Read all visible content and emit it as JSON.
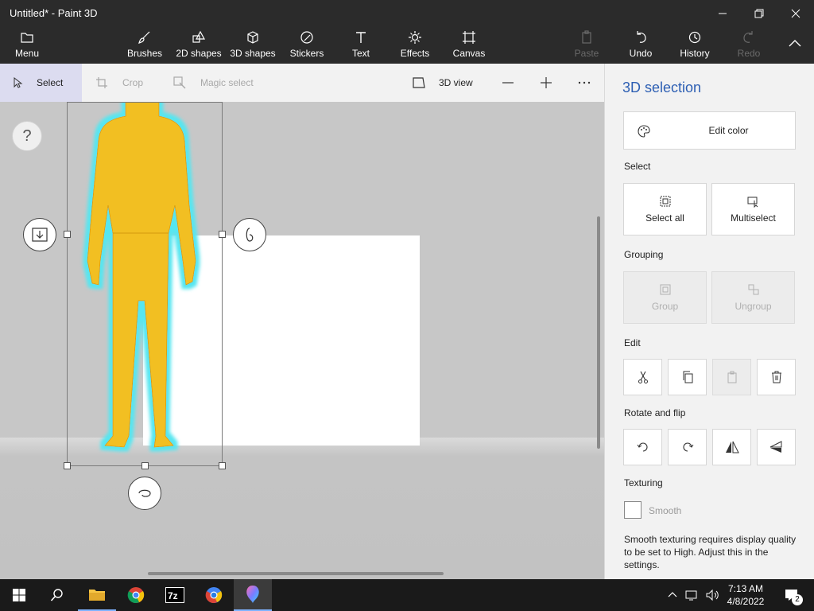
{
  "window": {
    "title": "Untitled* - Paint 3D"
  },
  "toolbar": {
    "menu": "Menu",
    "brushes": "Brushes",
    "shapes2d": "2D shapes",
    "shapes3d": "3D shapes",
    "stickers": "Stickers",
    "text": "Text",
    "effects": "Effects",
    "canvas": "Canvas",
    "paste": "Paste",
    "undo": "Undo",
    "history": "History",
    "redo": "Redo"
  },
  "subtoolbar": {
    "select": "Select",
    "crop": "Crop",
    "magic_select": "Magic select",
    "view3d": "3D view"
  },
  "canvas": {
    "help": "?"
  },
  "panel": {
    "title": "3D selection",
    "edit_color": "Edit color",
    "select_label": "Select",
    "select_all": "Select all",
    "multiselect": "Multiselect",
    "grouping_label": "Grouping",
    "group": "Group",
    "ungroup": "Ungroup",
    "edit_label": "Edit",
    "rotate_label": "Rotate and flip",
    "texturing_label": "Texturing",
    "smooth": "Smooth",
    "note": "Smooth texturing requires display quality to be set to High. Adjust this in the settings."
  },
  "taskbar": {
    "time": "7:13 AM",
    "date": "4/8/2022",
    "notifications": "2"
  },
  "colors": {
    "accent": "#2d5fb3",
    "figure": "#f2bf22",
    "glow": "#57e6f0"
  }
}
